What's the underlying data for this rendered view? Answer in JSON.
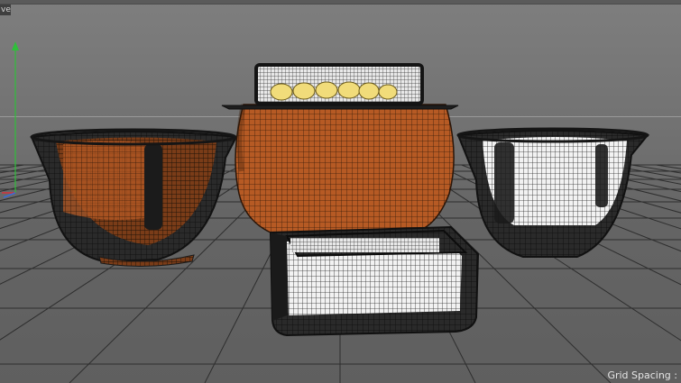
{
  "viewport": {
    "tab_label": "ve",
    "grid_spacing_label": "Grid Spacing :"
  },
  "colors": {
    "background": "#6f6f6f",
    "grid_line": "#2e2e2e",
    "axis_y": "#2fbf3a",
    "axis_x": "#d2323c",
    "axis_z": "#3a6ad8",
    "wire_dark": "#1c1c1c",
    "orange_surface": "#b65a24",
    "white_surface": "#f2f2f2",
    "yellow_balls": "#f1dc7a"
  },
  "objects": [
    {
      "name": "left-bowl",
      "material": "orange-wireframe"
    },
    {
      "name": "center-pot",
      "material": "orange-wireframe"
    },
    {
      "name": "lid-tray",
      "material": "white-wireframe"
    },
    {
      "name": "right-bowl",
      "material": "white-wireframe"
    },
    {
      "name": "front-square-dish",
      "material": "white-wireframe"
    }
  ]
}
